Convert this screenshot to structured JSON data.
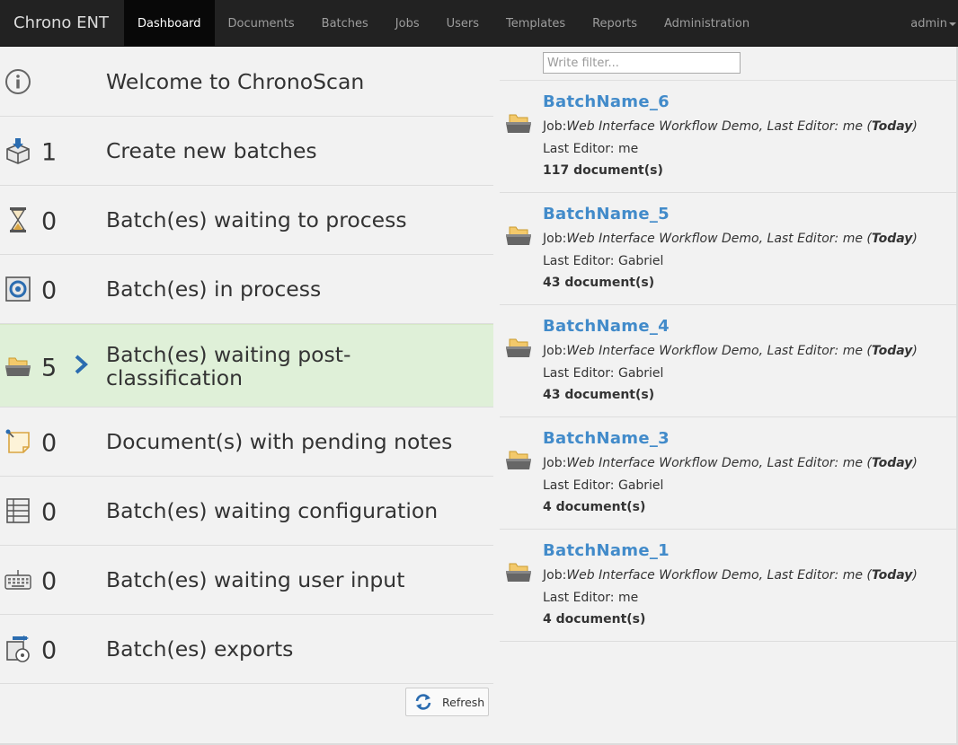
{
  "navbar": {
    "brand": "Chrono ENT",
    "items": [
      {
        "label": "Dashboard",
        "active": true
      },
      {
        "label": "Documents"
      },
      {
        "label": "Batches"
      },
      {
        "label": "Jobs"
      },
      {
        "label": "Users"
      },
      {
        "label": "Templates"
      },
      {
        "label": "Reports"
      },
      {
        "label": "Administration"
      }
    ],
    "user": "admin"
  },
  "dashboard": {
    "rows": [
      {
        "icon": "info-icon",
        "count": "",
        "label": "Welcome to ChronoScan"
      },
      {
        "icon": "new-batch-box-icon",
        "count": "1",
        "label": "Create new batches"
      },
      {
        "icon": "hourglass-icon",
        "count": "0",
        "label": "Batch(es) waiting to process"
      },
      {
        "icon": "process-gear-icon",
        "count": "0",
        "label": "Batch(es) in process"
      },
      {
        "icon": "folder-tray-icon",
        "count": "5",
        "label": "Batch(es) waiting post-classification"
      },
      {
        "icon": "sticky-note-icon",
        "count": "0",
        "label": "Document(s) with pending notes"
      },
      {
        "icon": "config-list-icon",
        "count": "0",
        "label": "Batch(es) waiting configuration"
      },
      {
        "icon": "keyboard-icon",
        "count": "0",
        "label": "Batch(es) waiting user input"
      },
      {
        "icon": "export-disc-icon",
        "count": "0",
        "label": "Batch(es) exports"
      }
    ],
    "refresh_label": "Refresh"
  },
  "filter": {
    "placeholder": "Write filter..."
  },
  "batches": [
    {
      "name": "BatchName_6",
      "job_prefix": "Job:",
      "job": "Web Interface Workflow Demo, Last Editor: me (",
      "job_day": "Today",
      "job_suffix": ")",
      "last_editor": "Last Editor: me",
      "docs": "117 document(s)"
    },
    {
      "name": "BatchName_5",
      "job_prefix": "Job:",
      "job": "Web Interface Workflow Demo, Last Editor: me (",
      "job_day": "Today",
      "job_suffix": ")",
      "last_editor": "Last Editor: Gabriel",
      "docs": "43 document(s)"
    },
    {
      "name": "BatchName_4",
      "job_prefix": "Job:",
      "job": "Web Interface Workflow Demo, Last Editor: me (",
      "job_day": "Today",
      "job_suffix": ")",
      "last_editor": "Last Editor: Gabriel",
      "docs": "43 document(s)"
    },
    {
      "name": "BatchName_3",
      "job_prefix": "Job:",
      "job": "Web Interface Workflow Demo, Last Editor: me (",
      "job_day": "Today",
      "job_suffix": ")",
      "last_editor": "Last Editor: Gabriel",
      "docs": "4 document(s)"
    },
    {
      "name": "BatchName_1",
      "job_prefix": "Job:",
      "job": "Web Interface Workflow Demo, Last Editor: me (",
      "job_day": "Today",
      "job_suffix": ")",
      "last_editor": "Last Editor: me",
      "docs": "4 document(s)"
    }
  ],
  "colors": {
    "nav_bg": "#222222",
    "highlight": "#dff0d8",
    "link": "#428bca"
  }
}
